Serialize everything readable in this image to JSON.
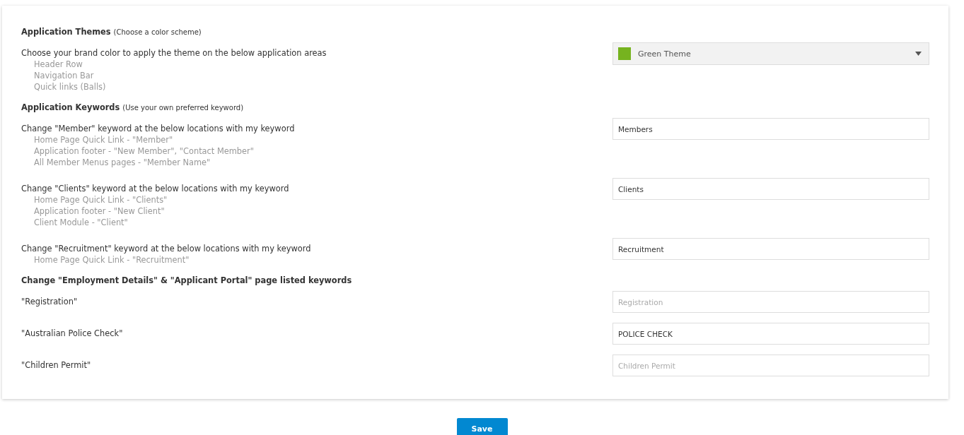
{
  "sections": [
    {
      "title": "Application Themes",
      "note": "(Choose a color scheme)",
      "rows": [
        {
          "kind": "select",
          "label": "Choose your brand color to apply the theme on the below application areas",
          "items": [
            "Header Row",
            "Navigation Bar",
            "Quick links (Balls)"
          ],
          "value": "Green Theme",
          "color": "#76b31f"
        }
      ]
    },
    {
      "title": "Application Keywords",
      "note": "(Use your own preferred keyword)",
      "rows": [
        {
          "kind": "input",
          "label": "Change \"Member\" keyword at the below locations with my keyword",
          "items": [
            "Home Page Quick Link - \"Member\"",
            "Application footer - \"New Member\", \"Contact Member\"",
            "All Member Menus pages - \"Member Name\""
          ],
          "value": "Members"
        },
        {
          "kind": "input",
          "label": "Change \"Clients\" keyword at the below locations with my keyword",
          "items": [
            "Home Page Quick Link - \"Clients\"",
            "Application footer - \"New Client\"",
            "Client Module - \"Client\""
          ],
          "value": "Clients"
        },
        {
          "kind": "input",
          "label": "Change \"Recruitment\" keyword at the below locations with my keyword",
          "items": [
            "Home Page Quick Link - \"Recruitment\""
          ],
          "value": "Recruitment"
        }
      ]
    },
    {
      "title": "Change \"Employment Details\" & \"Applicant Portal\" page listed keywords",
      "rows": [
        {
          "kind": "input",
          "label": "\"Registration\"",
          "placeholder": "Registration"
        },
        {
          "kind": "input",
          "label": "\"Australian Police Check\"",
          "value": "POLICE CHECK"
        },
        {
          "kind": "input",
          "label": "\"Children Permit\"",
          "placeholder": "Children Permit"
        }
      ]
    }
  ],
  "save_button": "Save"
}
